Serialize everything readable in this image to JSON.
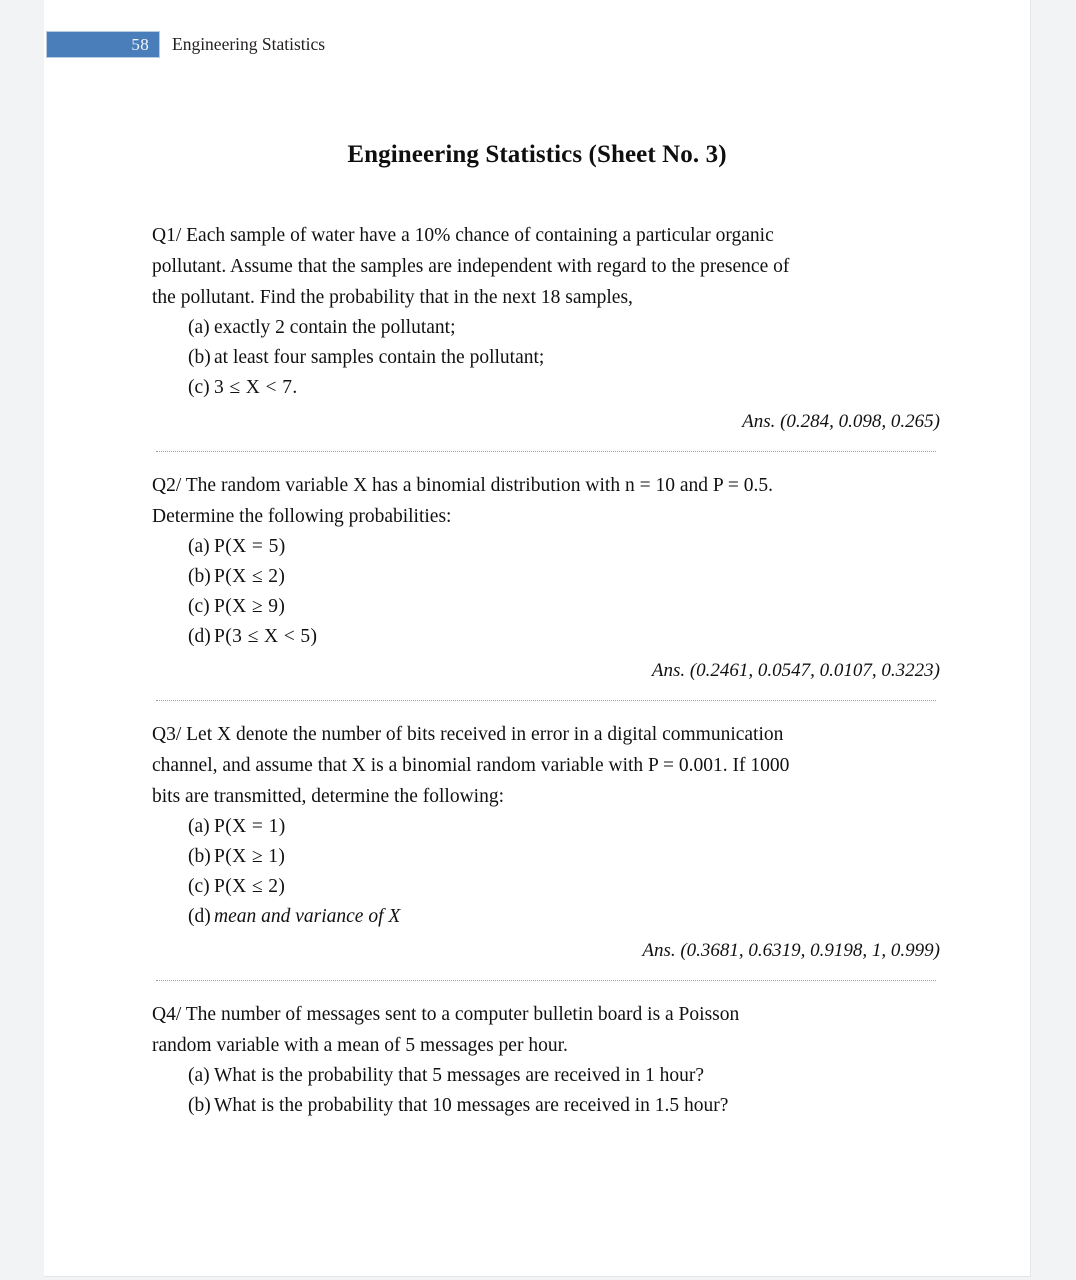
{
  "header": {
    "page_number": "58",
    "title": "Engineering Statistics"
  },
  "sheet_title": "Engineering Statistics (Sheet No. 3)",
  "questions": [
    {
      "id": "q1",
      "body_lines": [
        "Q1/ Each sample of water have a 10% chance of containing a particular organic",
        "pollutant. Assume that the samples are independent with regard to the presence of",
        "the pollutant. Find the probability that in the next 18 samples,"
      ],
      "items": [
        {
          "label": "(a)",
          "text": "exactly 2 contain the pollutant;"
        },
        {
          "label": "(b)",
          "text": "at least four samples contain the pollutant;"
        },
        {
          "label": "(c)",
          "text": "3 ≤ X < 7."
        }
      ],
      "answer": "Ans. (0.284, 0.098, 0.265)"
    },
    {
      "id": "q2",
      "body_lines": [
        "Q2/ The random variable X has a binomial distribution with n = 10 and P = 0.5.",
        "Determine the following probabilities:"
      ],
      "items": [
        {
          "label": "(a)",
          "text": "P(X = 5)"
        },
        {
          "label": "(b)",
          "text": "P(X ≤ 2)"
        },
        {
          "label": "(c)",
          "text": "P(X ≥ 9)"
        },
        {
          "label": "(d)",
          "text": "P(3 ≤ X < 5)"
        }
      ],
      "answer": "Ans. (0.2461, 0.0547, 0.0107, 0.3223)"
    },
    {
      "id": "q3",
      "body_lines": [
        "Q3/ Let X denote the number of bits received in error in a digital communication",
        "channel, and assume that X is a binomial random variable with P = 0.001. If 1000",
        "bits are transmitted, determine the following:"
      ],
      "items": [
        {
          "label": "(a)",
          "text": "P(X = 1)"
        },
        {
          "label": "(b)",
          "text": "P(X ≥ 1)"
        },
        {
          "label": "(c)",
          "text": "P(X ≤ 2)"
        },
        {
          "label": "(d)",
          "text": "mean and variance of X"
        }
      ],
      "answer": "Ans. (0.3681, 0.6319, 0.9198, 1, 0.999)"
    },
    {
      "id": "q4",
      "body_lines": [
        "Q4/ The number of messages sent to a computer bulletin board is a Poisson",
        "random variable with a mean of 5 messages per hour."
      ],
      "items": [
        {
          "label": "(a)",
          "text": "What is the probability that 5 messages are received in 1 hour?"
        },
        {
          "label": "(b)",
          "text": "What is the probability that 10 messages are received in 1.5 hour?"
        }
      ],
      "answer": ""
    }
  ],
  "colors": {
    "page_band": "#4a7ebb",
    "page_band_border": "#b9cce0",
    "page_background": "#f1f3f4",
    "paper": "#ffffff",
    "text": "#111111"
  }
}
